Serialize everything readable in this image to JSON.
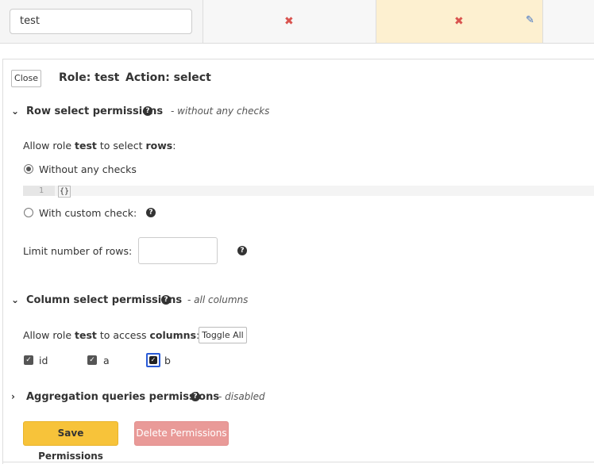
{
  "table_row": {
    "role_value": "test",
    "cell_a_icon": "✖",
    "cell_b_icon": "✖",
    "edit_icon": "✎"
  },
  "panel": {
    "close_label": "Close",
    "role_header": "Role: test",
    "action_header": "Action: select"
  },
  "row_section": {
    "title": "Row select permissions",
    "note": "- without any checks",
    "allow_prefix": "Allow role ",
    "allow_role": "test",
    "allow_mid": " to select ",
    "allow_target": "rows",
    "allow_suffix": ":",
    "option_without": "Without any checks",
    "option_custom": "With custom check:",
    "editor_line_number": "1",
    "editor_code": "{}",
    "limit_label": "Limit number of rows:",
    "limit_value": ""
  },
  "column_section": {
    "title": "Column select permissions",
    "note": "- all columns",
    "allow_prefix": "Allow role ",
    "allow_role": "test",
    "allow_mid": " to access ",
    "allow_target": "columns",
    "allow_suffix": ":",
    "toggle_all_label": "Toggle All",
    "columns": [
      {
        "name": "id",
        "checked": true
      },
      {
        "name": "a",
        "checked": true
      },
      {
        "name": "b",
        "checked": true
      }
    ]
  },
  "aggregation_section": {
    "title": "Aggregation queries permissions",
    "note": "- disabled"
  },
  "actions": {
    "save_label": "Save Permissions",
    "delete_label": "Delete Permissions"
  },
  "colors": {
    "save": "#f7c33a",
    "delete": "#e99a98",
    "highlight_cell": "#fdf0d0",
    "deny": "#d9534f",
    "focus": "#2a5bd7"
  }
}
